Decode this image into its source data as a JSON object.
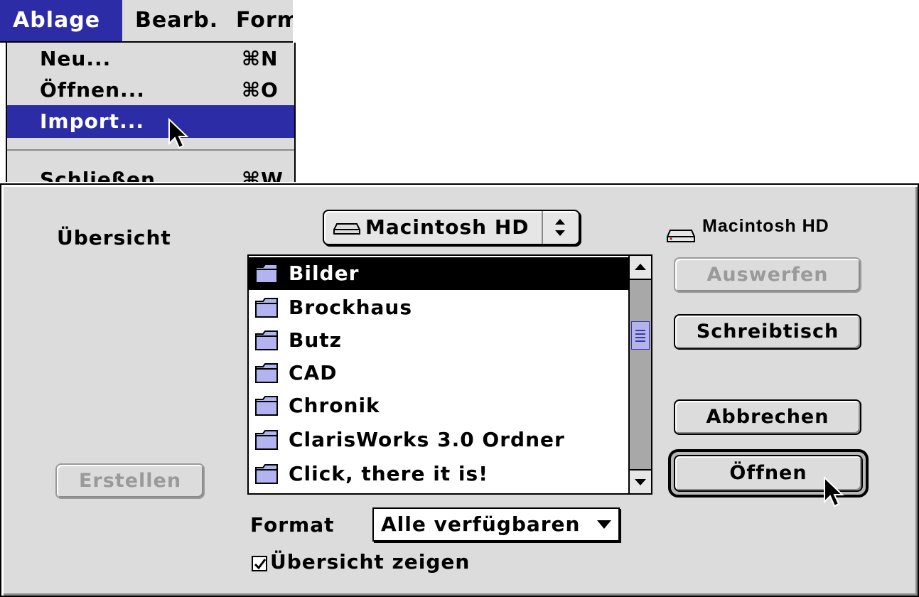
{
  "menubar": {
    "items": [
      {
        "label": "Ablage",
        "selected": true
      },
      {
        "label": "Bearb.",
        "selected": false
      },
      {
        "label": "Form",
        "selected": false
      }
    ]
  },
  "file_menu": {
    "items": [
      {
        "label": "Neu...",
        "shortcut": "⌘N",
        "highlighted": false
      },
      {
        "label": "Öffnen...",
        "shortcut": "⌘O",
        "highlighted": false
      },
      {
        "label": "Import...",
        "shortcut": "",
        "highlighted": true
      },
      {
        "label": "Schließen",
        "shortcut": "⌘W",
        "highlighted": false
      }
    ]
  },
  "dialog": {
    "preview_label": "Übersicht",
    "create_button": "Erstellen",
    "volume_popup": "Macintosh HD",
    "volume_label": "Macintosh HD",
    "eject_button": "Auswerfen",
    "desktop_button": "Schreibtisch",
    "cancel_button": "Abbrechen",
    "open_button": "Öffnen",
    "files": [
      {
        "name": "Bilder",
        "selected": true
      },
      {
        "name": "Brockhaus",
        "selected": false
      },
      {
        "name": "Butz",
        "selected": false
      },
      {
        "name": "CAD",
        "selected": false
      },
      {
        "name": "Chronik",
        "selected": false
      },
      {
        "name": "ClarisWorks 3.0 Ordner",
        "selected": false
      },
      {
        "name": "Click, there it is!",
        "selected": false
      }
    ],
    "format_label": "Format",
    "format_value": "Alle verfügbaren",
    "show_preview_label": "Übersicht zeigen",
    "show_preview_checked": true
  },
  "colors": {
    "menu_highlight": "#2c2ca6",
    "chrome_gray": "#dcdcdc",
    "folder_fill": "#b3b3ef",
    "scroll_thumb": "#b3b3ef"
  }
}
